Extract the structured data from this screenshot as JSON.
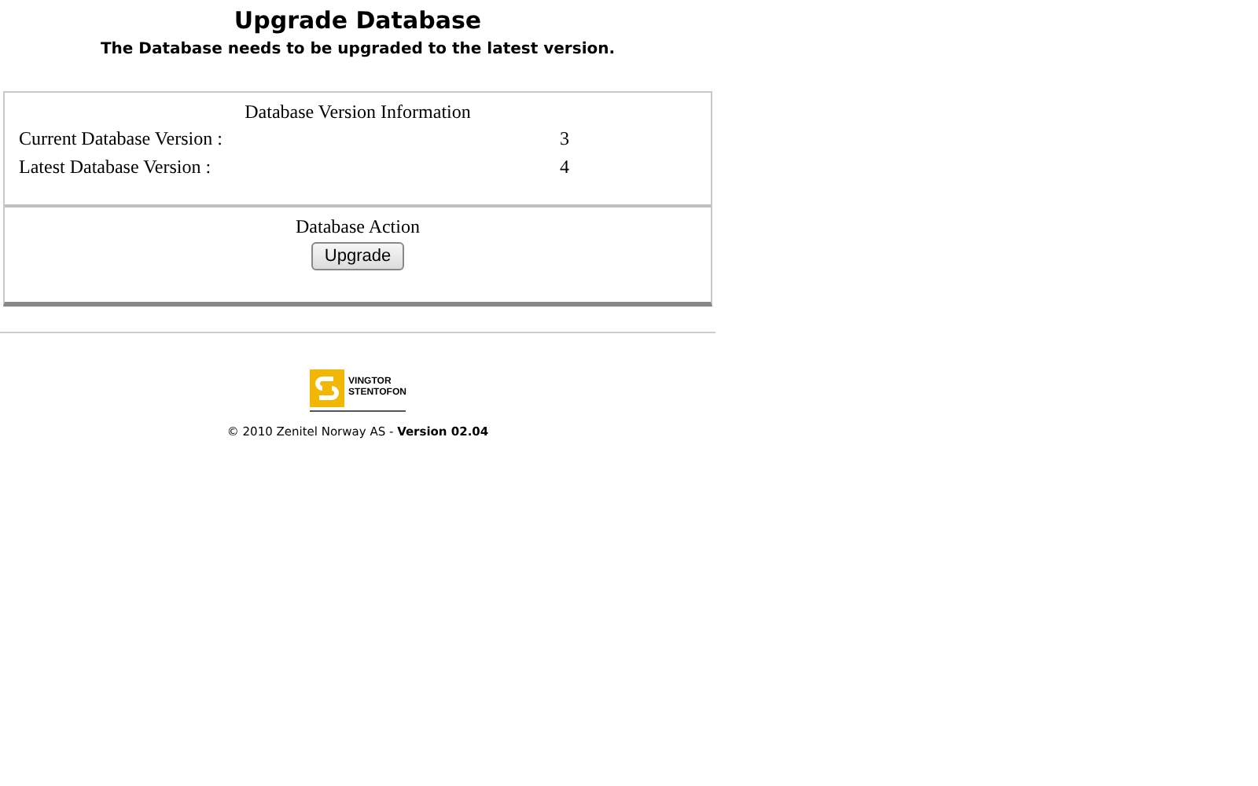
{
  "title": "Upgrade Database",
  "subtitle": "The Database needs to be upgraded to the latest version.",
  "info": {
    "heading": "Database Version Information",
    "rows": [
      {
        "label": "Current Database Version :",
        "value": "3"
      },
      {
        "label": "Latest Database Version :",
        "value": "4"
      }
    ]
  },
  "action": {
    "heading": "Database Action",
    "button": "Upgrade"
  },
  "logo": {
    "line_1": "VINGTOR",
    "line_2": "STENTOFON"
  },
  "copyright": "© 2010 Zenitel Norway AS - **Version 02.04**"
}
